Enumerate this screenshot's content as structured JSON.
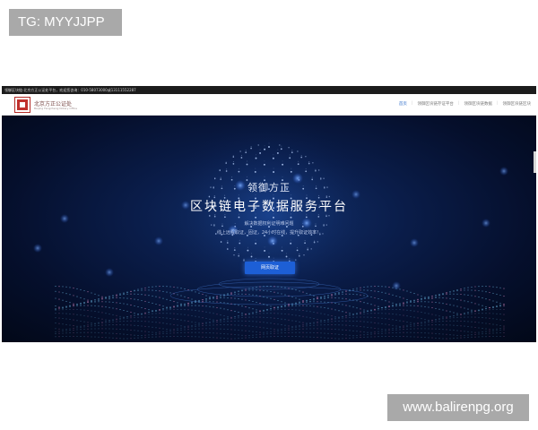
{
  "watermarks": {
    "top_left": "TG: MYYJJPP",
    "bottom_right": "www.balirenpg.org"
  },
  "website": {
    "notice": "领御区块链·北京方正公证处平台，欢迎您咨询：010-58073000或13111552287",
    "logo": {
      "name": "北京方正公证处",
      "subtitle": "Beijing Fangzheng Notary Office"
    },
    "nav": {
      "items": [
        "首页",
        "领御区块链存证平台",
        "领御区块链数据",
        "领御区块链区块"
      ],
      "active_index": 0
    },
    "hero": {
      "brand": "领御方正",
      "title": "区块链电子数据服务平台",
      "line1": "解决数据权利证明难问题",
      "line2": "线上远程取证，固证，24小时在线，提升取证效率！",
      "cta_label": "网页取证"
    }
  },
  "colors": {
    "hero_bg": "#0a1d4a",
    "cta": "#1d5fd6",
    "logo_red": "#c0302c",
    "watermark_bg": "#a9a9a9",
    "active_nav": "#2a6ac8"
  }
}
